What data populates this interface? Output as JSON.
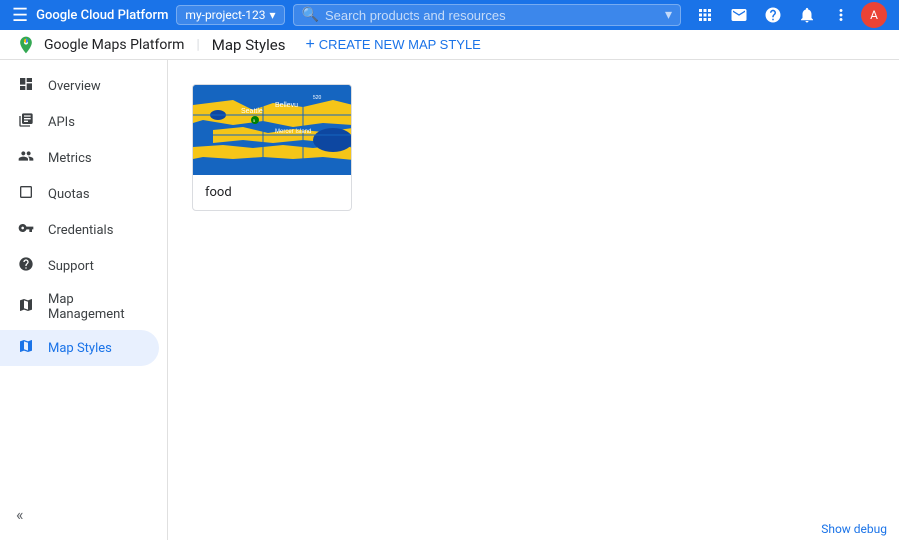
{
  "topbar": {
    "app_title": "Google Cloud Platform",
    "project_name": "my-project-123",
    "search_placeholder": "Search products and resources",
    "hamburger_icon": "☰",
    "search_icon": "🔍",
    "chevron_icon": "▾",
    "notifications_icon": "🔔",
    "help_icon": "?",
    "apps_icon": "⊞",
    "more_icon": "⋮",
    "avatar_text": "A"
  },
  "secondbar": {
    "maps_title": "Google Maps Platform",
    "page_title": "Map Styles",
    "create_btn_label": "CREATE NEW MAP STYLE",
    "create_icon": "+"
  },
  "sidebar": {
    "items": [
      {
        "label": "Overview",
        "icon": "⊙",
        "id": "overview"
      },
      {
        "label": "APIs",
        "icon": "≡",
        "id": "apis"
      },
      {
        "label": "Metrics",
        "icon": "▐",
        "id": "metrics"
      },
      {
        "label": "Quotas",
        "icon": "☐",
        "id": "quotas"
      },
      {
        "label": "Credentials",
        "icon": "⚿",
        "id": "credentials"
      },
      {
        "label": "Support",
        "icon": "👤",
        "id": "support"
      },
      {
        "label": "Map Management",
        "icon": "▦",
        "id": "map-management"
      },
      {
        "label": "Map Styles",
        "icon": "◉",
        "id": "map-styles",
        "active": true
      }
    ],
    "collapse_icon": "«"
  },
  "main": {
    "map_style_card": {
      "label": "food"
    }
  },
  "bottombar": {
    "debug_label": "Show debug"
  }
}
